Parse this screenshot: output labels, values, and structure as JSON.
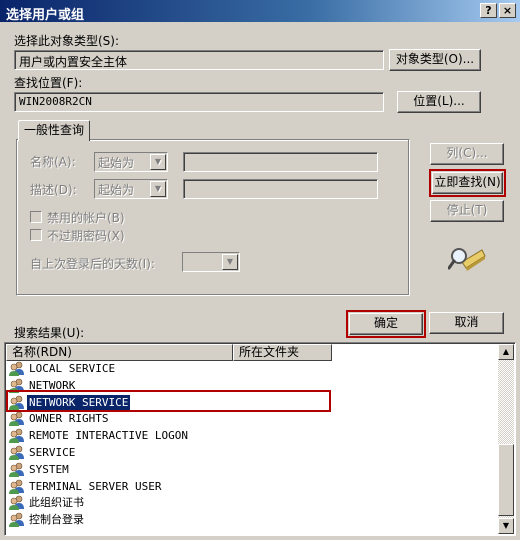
{
  "window": {
    "title": "选择用户或组",
    "help_label": "?",
    "close_label": "×"
  },
  "object_type": {
    "label": "选择此对象类型(S):",
    "value": "用户或内置安全主体",
    "button": "对象类型(O)..."
  },
  "location": {
    "label": "查找位置(F):",
    "value": "WIN2008R2CN",
    "button": "位置(L)..."
  },
  "query_tab": {
    "label": "一般性查询"
  },
  "query": {
    "name_label": "名称(A):",
    "name_mode": "起始为",
    "desc_label": "描述(D):",
    "desc_mode": "起始为",
    "disabled_accounts": "禁用的帐户(B)",
    "no_expire_pwd": "不过期密码(X)",
    "days_since_login": "自上次登录后的天数(I):"
  },
  "buttons": {
    "columns": "列(C)...",
    "find_now": "立即查找(N)",
    "stop": "停止(T)",
    "ok": "确定",
    "cancel": "取消"
  },
  "results": {
    "label": "搜索结果(U):",
    "columns": [
      "名称(RDN)",
      "所在文件夹"
    ],
    "rows": [
      "LOCAL SERVICE",
      "NETWORK",
      "NETWORK SERVICE",
      "OWNER RIGHTS",
      "REMOTE INTERACTIVE LOGON",
      "SERVICE",
      "SYSTEM",
      "TERMINAL SERVER USER",
      "此组织证书",
      "控制台登录"
    ],
    "selected_index": 2
  },
  "colors": {
    "title_start": "#0a246a",
    "title_end": "#a6caf0",
    "selection": "#0a246a",
    "highlight_outline": "#b00000"
  }
}
